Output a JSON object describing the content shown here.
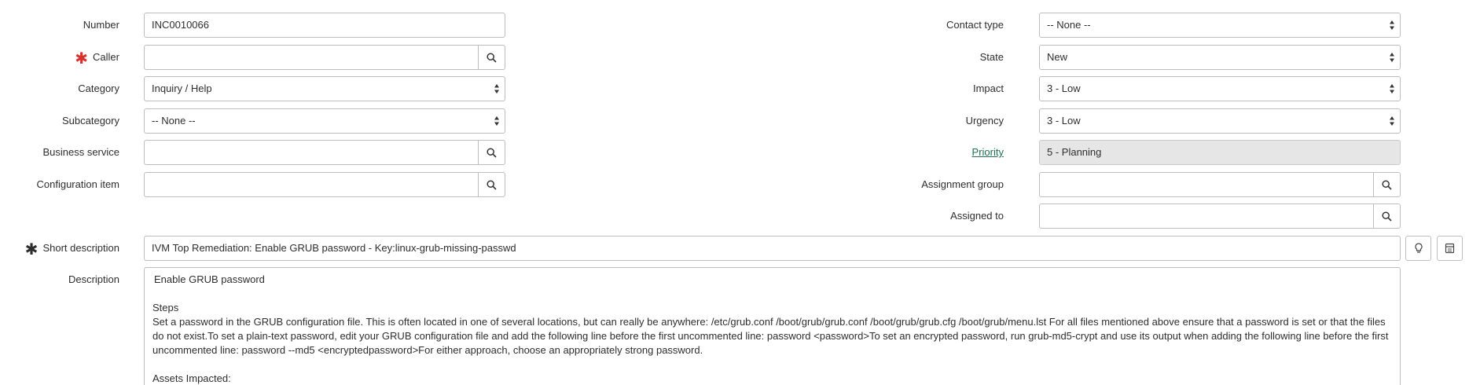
{
  "left": {
    "number": {
      "label": "Number",
      "value": "INC0010066"
    },
    "caller": {
      "label": "Caller",
      "value": ""
    },
    "category": {
      "label": "Category",
      "value": "Inquiry / Help"
    },
    "subcategory": {
      "label": "Subcategory",
      "value": "-- None --"
    },
    "business_service": {
      "label": "Business service",
      "value": ""
    },
    "configuration_item": {
      "label": "Configuration item",
      "value": ""
    }
  },
  "right": {
    "contact_type": {
      "label": "Contact type",
      "value": "-- None --"
    },
    "state": {
      "label": "State",
      "value": "New"
    },
    "impact": {
      "label": "Impact",
      "value": "3 - Low"
    },
    "urgency": {
      "label": "Urgency",
      "value": "3 - Low"
    },
    "priority": {
      "label": "Priority",
      "value": "5 - Planning"
    },
    "assignment_group": {
      "label": "Assignment group",
      "value": ""
    },
    "assigned_to": {
      "label": "Assigned to",
      "value": ""
    }
  },
  "short_description": {
    "label": "Short description",
    "value": "IVM Top Remediation:  Enable GRUB password  - Key:linux-grub-missing-passwd"
  },
  "description": {
    "label": "Description",
    "line1": "Enable GRUB password",
    "line2": "Steps",
    "line3": "Set a password in the GRUB configuration file. This is often located in one of several locations, but can really be anywhere: /etc/grub.conf /boot/grub/grub.conf /boot/grub/grub.cfg /boot/grub/menu.lst For all files mentioned above ensure that a password is set or that the files do not exist.To set a plain-text password, edit your GRUB configuration file and add the following line before the first uncommented line: password <password>To set an encrypted password, run grub-md5-crypt and use its output when adding the following line before the first uncommented line: password --md5 <encryptedpassword>For either approach, choose an appropriately strong password.",
    "line4": "Assets Impacted:"
  },
  "icons": {
    "lookup": "search-icon",
    "suggestion": "lightbulb-icon",
    "template": "template-icon",
    "required": "asterisk-icon",
    "select_arrows": "select-arrows-icon"
  },
  "colors": {
    "required_mark": "#d9302b",
    "link": "#1f6f51",
    "readonly_bg": "#e6e6e6",
    "border": "#bdbdbd"
  }
}
